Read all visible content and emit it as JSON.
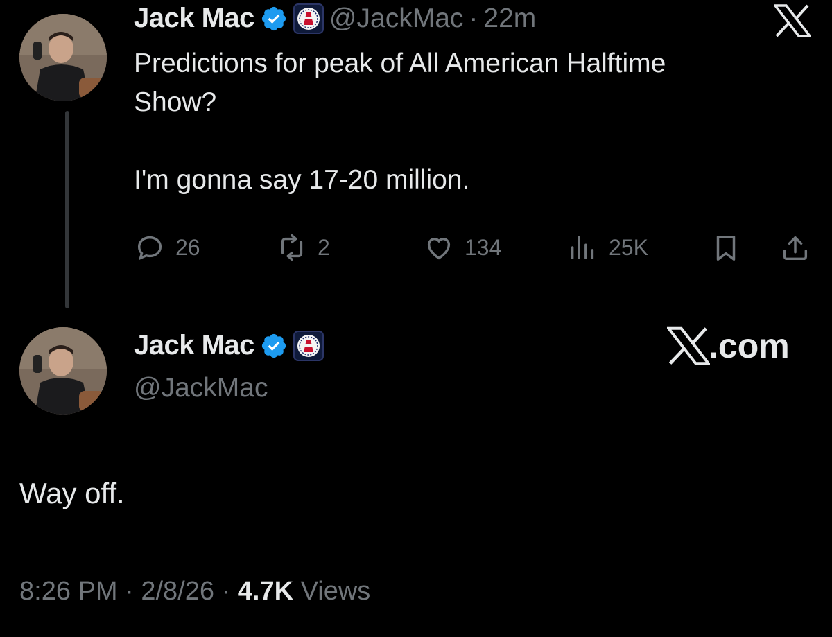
{
  "quoted_tweet": {
    "name": "Jack Mac",
    "handle": "@JackMac",
    "separator": "·",
    "time_ago": "22m",
    "text_line1": "Predictions for peak of All American Halftime",
    "text_line2": "Show?",
    "text_line3": "I'm gonna say 17-20 million.",
    "actions": {
      "replies": "26",
      "reposts": "2",
      "likes": "134",
      "views": "25K"
    }
  },
  "reply_tweet": {
    "name": "Jack Mac",
    "handle": "@JackMac",
    "brand": "X.com",
    "text": "Way off.",
    "time": "8:26 PM",
    "date": "2/8/26",
    "views_count": "4.7K",
    "views_label": "Views",
    "separator": "·"
  },
  "icons": {
    "verified": "verified-badge-icon",
    "org": "barstool-affiliate-icon",
    "x_logo": "x-logo-icon"
  },
  "colors": {
    "background": "#000000",
    "text_primary": "#e7e9ea",
    "text_secondary": "#71767b",
    "verified_blue": "#1d9bf0"
  }
}
